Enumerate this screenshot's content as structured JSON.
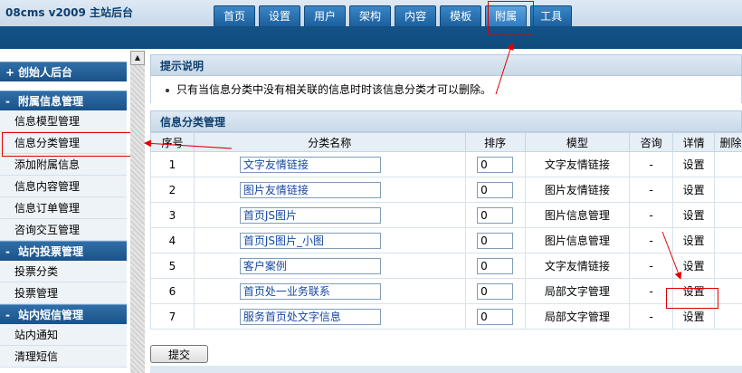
{
  "app": {
    "brand": "08cms v2009 主站后台"
  },
  "nav": [
    {
      "label": "首页"
    },
    {
      "label": "设置"
    },
    {
      "label": "用户"
    },
    {
      "label": "架构"
    },
    {
      "label": "内容"
    },
    {
      "label": "模板"
    },
    {
      "label": "附属"
    },
    {
      "label": "工具"
    }
  ],
  "nav_active": "附属",
  "sidebar": {
    "founder": {
      "sign": "+",
      "label": "创始人后台"
    },
    "attached": {
      "sign": "-",
      "label": "附属信息管理",
      "items": [
        {
          "label": "信息模型管理"
        },
        {
          "label": "信息分类管理"
        },
        {
          "label": "添加附属信息"
        },
        {
          "label": "信息内容管理"
        },
        {
          "label": "信息订单管理"
        },
        {
          "label": "咨询交互管理"
        }
      ]
    },
    "vote": {
      "sign": "-",
      "label": "站内投票管理",
      "items": [
        {
          "label": "投票分类"
        },
        {
          "label": "投票管理"
        }
      ]
    },
    "sms": {
      "sign": "-",
      "label": "站内短信管理",
      "items": [
        {
          "label": "站内通知"
        },
        {
          "label": "清理短信"
        }
      ]
    }
  },
  "tip": {
    "title": "提示说明",
    "text": "只有当信息分类中没有相关联的信息时时该信息分类才可以删除。"
  },
  "table": {
    "title": "信息分类管理",
    "headers": {
      "no": "序号",
      "name": "分类名称",
      "sort": "排序",
      "model": "模型",
      "consult": "咨询",
      "detail": "详情",
      "del": "删除"
    },
    "rows": [
      {
        "no": "1",
        "name": "文字友情链接",
        "sort": "0",
        "model": "文字友情链接",
        "consult": "-",
        "detail": "设置"
      },
      {
        "no": "2",
        "name": "图片友情链接",
        "sort": "0",
        "model": "图片友情链接",
        "consult": "-",
        "detail": "设置"
      },
      {
        "no": "3",
        "name": "首页JS图片",
        "sort": "0",
        "model": "图片信息管理",
        "consult": "-",
        "detail": "设置"
      },
      {
        "no": "4",
        "name": "首页JS图片_小图",
        "sort": "0",
        "model": "图片信息管理",
        "consult": "-",
        "detail": "设置"
      },
      {
        "no": "5",
        "name": "客户案例",
        "sort": "0",
        "model": "文字友情链接",
        "consult": "-",
        "detail": "设置"
      },
      {
        "no": "6",
        "name": "首页处一业务联系",
        "sort": "0",
        "model": "局部文字管理",
        "consult": "-",
        "detail": "设置"
      },
      {
        "no": "7",
        "name": "服务首页处文字信息",
        "sort": "0",
        "model": "局部文字管理",
        "consult": "-",
        "detail": "设置"
      }
    ]
  },
  "submit": {
    "label": "提交"
  },
  "colors": {
    "header": "#0f4a7c",
    "sidebar_head": "#1b5288",
    "highlight": "#e00000"
  }
}
